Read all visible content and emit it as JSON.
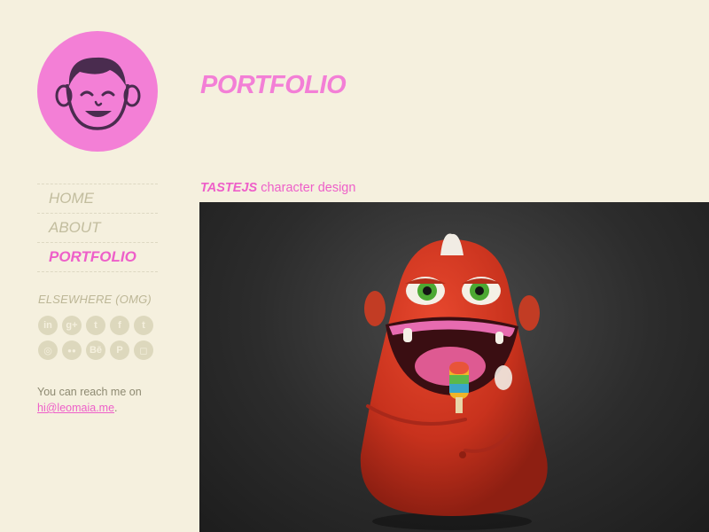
{
  "header": {
    "title": "PORTFOLIO"
  },
  "nav": {
    "items": [
      {
        "label": "HOME",
        "active": false
      },
      {
        "label": "ABOUT",
        "active": false
      },
      {
        "label": "PORTFOLIO",
        "active": true
      }
    ]
  },
  "elsewhere": {
    "heading": "ELSEWHERE (OMG)",
    "icons": [
      {
        "name": "linkedin-icon",
        "glyph": "in"
      },
      {
        "name": "googleplus-icon",
        "glyph": "g+"
      },
      {
        "name": "twitter-icon",
        "glyph": "t"
      },
      {
        "name": "facebook-icon",
        "glyph": "f"
      },
      {
        "name": "tumblr-icon",
        "glyph": "t"
      },
      {
        "name": "dribbble-icon",
        "glyph": "◎"
      },
      {
        "name": "flickr-icon",
        "glyph": "●●"
      },
      {
        "name": "behance-icon",
        "glyph": "Bē"
      },
      {
        "name": "pinterest-icon",
        "glyph": "P"
      },
      {
        "name": "instagram-icon",
        "glyph": "◻"
      }
    ]
  },
  "contact": {
    "text": "You can reach me on",
    "email": "hi@leomaia.me",
    "suffix": "."
  },
  "project": {
    "name": "TASTEJS",
    "description": " character design"
  },
  "colors": {
    "background": "#f5f0de",
    "accent": "#f37fd6",
    "nav_inactive": "#c2bd9e"
  }
}
